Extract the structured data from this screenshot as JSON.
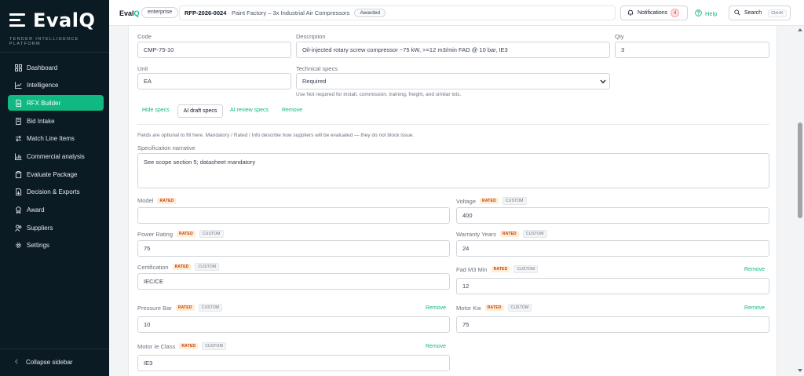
{
  "app": {
    "brand_prefix": "Eval",
    "brand_suffix": "Q",
    "tagline": "TENDER INTELLIGENCE PLATFORM",
    "tier": "enterprise"
  },
  "sidebar": {
    "items": [
      {
        "label": "Dashboard",
        "icon": "grid-icon"
      },
      {
        "label": "Intelligence",
        "icon": "chart-line-icon"
      },
      {
        "label": "RFX Builder",
        "icon": "document-icon",
        "active": true
      },
      {
        "label": "Bid Intake",
        "icon": "inbox-icon"
      },
      {
        "label": "Match Line Items",
        "icon": "swap-icon"
      },
      {
        "label": "Commercial analysis",
        "icon": "bar-chart-icon"
      },
      {
        "label": "Evaluate Package",
        "icon": "clipboard-icon"
      },
      {
        "label": "Decision & Exports",
        "icon": "export-icon"
      },
      {
        "label": "Award",
        "icon": "award-icon"
      },
      {
        "label": "Suppliers",
        "icon": "users-icon"
      },
      {
        "label": "Settings",
        "icon": "gear-icon"
      }
    ],
    "collapse_label": "Collapse sidebar"
  },
  "topbar": {
    "rfp_code": "RFP-2026-0024",
    "rfp_title": "· Paint Factory – 3x Industrial Air Compressors",
    "status": "Awarded",
    "notifications_label": "Notifications",
    "notifications_count": "4",
    "help_label": "Help",
    "search_label": "Search",
    "search_shortcut": "Ctrl+K"
  },
  "line_item": {
    "code_label": "Code",
    "code_value": "CMP-75-10",
    "description_label": "Description",
    "description_value": "Oil-injected rotary screw compressor ~75 kW, >=12 m3/min FAD @ 10 bar, IE3",
    "qty_label": "Qty",
    "qty_value": "3",
    "unit_label": "Unit",
    "unit_value": "EA",
    "tech_specs_label": "Technical specs",
    "tech_specs_value": "Required",
    "tech_specs_help": "Use Not required for install, commission, training, freight, and similar lots.",
    "actions": {
      "hide_specs": "Hide specs",
      "ai_draft": "AI draft specs",
      "ai_review": "AI review specs",
      "remove": "Remove"
    }
  },
  "specs": {
    "info_note": "Fields are optional to fill here. Mandatory / Rated / Info describe how suppliers will be evaluated — they do not block issue.",
    "narrative_label": "Specification narrative",
    "narrative_value": "See scope section 5; datasheet mandatory",
    "tag_rated": "RATED",
    "tag_custom": "CUSTOM",
    "remove_label": "Remove",
    "fields": {
      "model": {
        "label": "Model",
        "value": ""
      },
      "voltage": {
        "label": "Voltage",
        "value": "400"
      },
      "power_rating": {
        "label": "Power Rating",
        "value": "75"
      },
      "warranty_years": {
        "label": "Warranty Years",
        "value": "24"
      },
      "certification": {
        "label": "Certification",
        "value": "IEC/CE"
      },
      "fad_m3_min": {
        "label": "Fad M3 Min",
        "value": "12"
      },
      "pressure_bar": {
        "label": "Pressure Bar",
        "value": "10"
      },
      "motor_kw": {
        "label": "Motor Kw",
        "value": "75"
      },
      "motor_ie_class": {
        "label": "Motor Ie Class",
        "value": "IE3"
      }
    }
  },
  "colors": {
    "sidebar_bg": "#0b1b24",
    "accent": "#10b981",
    "rated_bg": "#ffedd5",
    "rated_text": "#c2410c"
  }
}
